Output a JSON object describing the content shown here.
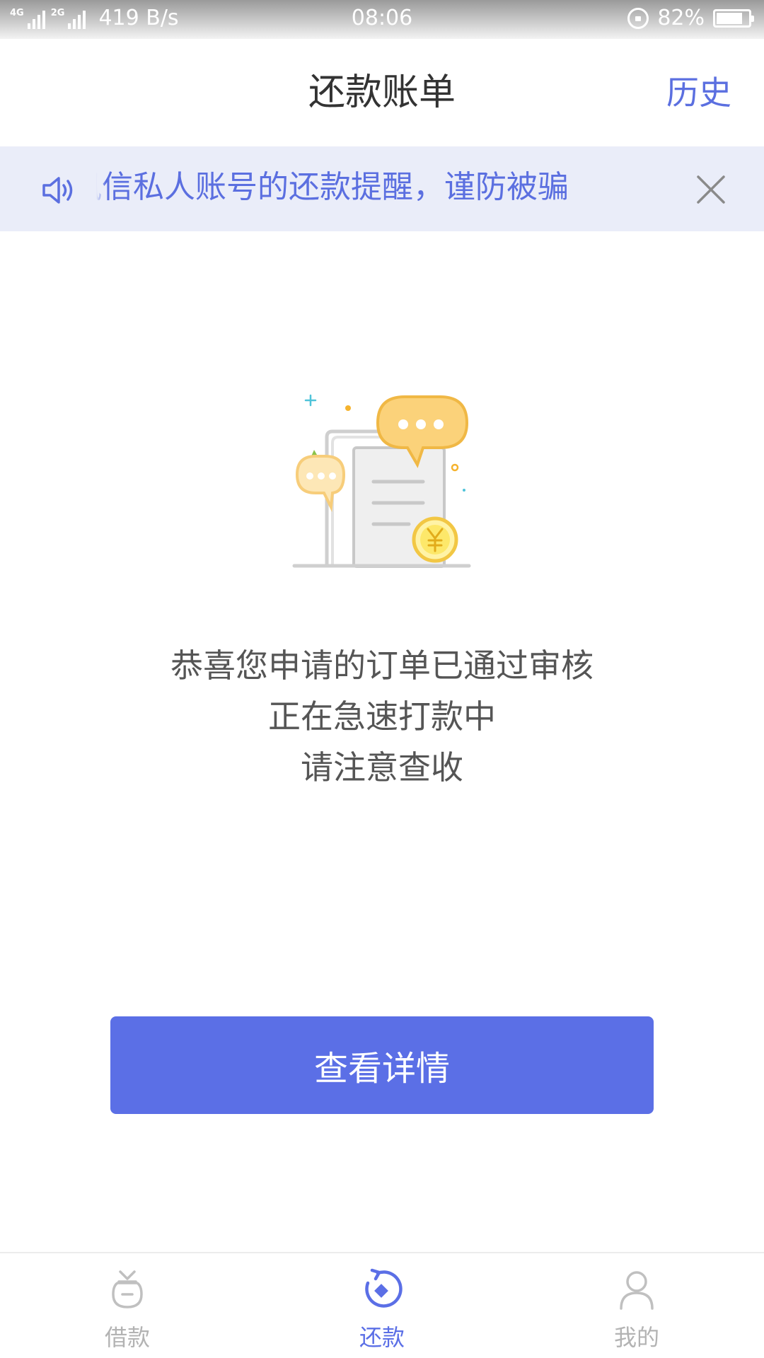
{
  "status_bar": {
    "signal1_label": "4G",
    "signal2_label": "2G",
    "net_speed": "419 B/s",
    "time": "08:06",
    "battery": "82%",
    "battery_level": 0.82
  },
  "header": {
    "title": "还款账单",
    "history_label": "历史"
  },
  "notice": {
    "text": "讯信私人账号的还款提醒，谨防被骗",
    "icon": "speaker-icon"
  },
  "message": {
    "lines": [
      "恭喜您申请的订单已通过审核",
      "正在急速打款中",
      "请注意查收"
    ]
  },
  "main_button": {
    "label": "查看详情"
  },
  "bottom_nav": {
    "items": [
      {
        "label": "借款",
        "icon": "loan-bag-icon",
        "active": false
      },
      {
        "label": "还款",
        "icon": "repay-cycle-icon",
        "active": true
      },
      {
        "label": "我的",
        "icon": "user-icon",
        "active": false
      }
    ]
  },
  "colors": {
    "accent": "#5b6fe6",
    "notice_bg": "#eaedf9",
    "text_dark": "#333333",
    "text_muted": "#555555",
    "nav_inactive": "#b3b3b3"
  }
}
